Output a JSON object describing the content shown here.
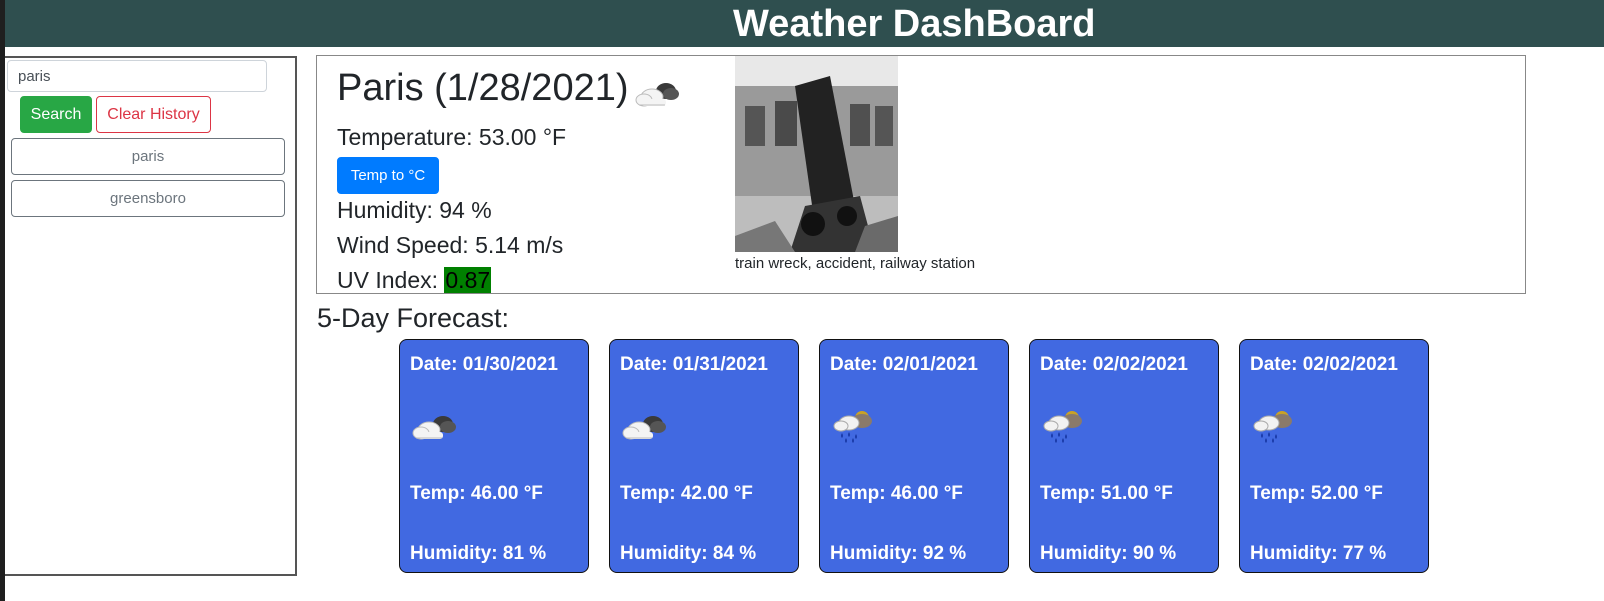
{
  "header": {
    "title": "Weather DashBoard"
  },
  "search": {
    "value": "paris",
    "button_label": "Search",
    "clear_label": "Clear History"
  },
  "history": [
    "paris",
    "greensboro"
  ],
  "current": {
    "title": "Paris (1/28/2021)",
    "icon": "cloudy-icon",
    "temperature": "Temperature: 53.00 °F",
    "temp_toggle_label": "Temp to °C",
    "humidity": "Humidity: 94 %",
    "wind": "Wind Speed: 5.14 m/s",
    "uv_label": "UV Index: ",
    "uv_value": "0.87",
    "uv_color": "#008000",
    "image_caption": "train wreck, accident, railway station"
  },
  "forecast": {
    "title": "5-Day Forecast:",
    "card_color": "#4169e1",
    "days": [
      {
        "date": "Date: 01/30/2021",
        "icon": "cloudy-icon",
        "temp": "Temp: 46.00 °F",
        "humidity": "Humidity: 81 %"
      },
      {
        "date": "Date: 01/31/2021",
        "icon": "cloudy-icon",
        "temp": "Temp: 42.00 °F",
        "humidity": "Humidity: 84 %"
      },
      {
        "date": "Date: 02/01/2021",
        "icon": "rain-icon",
        "temp": "Temp: 46.00 °F",
        "humidity": "Humidity: 92 %"
      },
      {
        "date": "Date: 02/02/2021",
        "icon": "rain-icon",
        "temp": "Temp: 51.00 °F",
        "humidity": "Humidity: 90 %"
      },
      {
        "date": "Date: 02/02/2021",
        "icon": "rain-icon",
        "temp": "Temp: 52.00 °F",
        "humidity": "Humidity: 77 %"
      }
    ]
  }
}
